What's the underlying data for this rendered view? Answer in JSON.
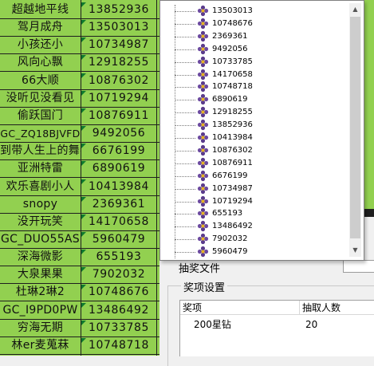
{
  "sheet": {
    "rows": [
      {
        "name": "超越地平线",
        "number": "13852936"
      },
      {
        "name": "驾月成舟",
        "number": "13503013"
      },
      {
        "name": "小孩还小",
        "number": "10734987"
      },
      {
        "name": "风向心飘",
        "number": "12918255"
      },
      {
        "name": "66大顺",
        "number": "10876302"
      },
      {
        "name": "没听见没看见",
        "number": "10719294"
      },
      {
        "name": "偷跃国门",
        "number": "10876911"
      },
      {
        "name": "GC_ZQ18BJVFD",
        "number": "9492056"
      },
      {
        "name": "到带人生上的舞者",
        "number": "6676199"
      },
      {
        "name": "亚洲特雷",
        "number": "6890619"
      },
      {
        "name": "欢乐喜剧小人",
        "number": "10413984"
      },
      {
        "name": "snopy",
        "number": "2369361"
      },
      {
        "name": "没开玩笑",
        "number": "14170658"
      },
      {
        "name": "GC_DUO55AS",
        "number": "5960479"
      },
      {
        "name": "深海微影",
        "number": "655193"
      },
      {
        "name": "大泉果果",
        "number": "7902032"
      },
      {
        "name": "杜琳2琳2",
        "number": "10748676"
      },
      {
        "name": "GC_I9PD0PW",
        "number": "13486492"
      },
      {
        "name": "穷海无期",
        "number": "10733785"
      },
      {
        "name": "林er麦蒐菻",
        "number": "10748718"
      }
    ]
  },
  "tree": {
    "icon": "flower-user-icon",
    "items": [
      "13503013",
      "10748676",
      "2369361",
      "9492056",
      "10733785",
      "14170658",
      "10748718",
      "6890619",
      "12918255",
      "13852936",
      "10413984",
      "10876302",
      "10876911",
      "6676199",
      "10734987",
      "10719294",
      "655193",
      "13486492",
      "7902032",
      "5960479"
    ],
    "scroll_up": "▲",
    "scroll_down": "▼"
  },
  "form": {
    "hidden_label": "抽奖文件"
  },
  "prize": {
    "group_title": "奖项设置",
    "columns": [
      "奖项",
      "抽取人数"
    ],
    "rows": [
      {
        "prize": "200星钻",
        "count": "20"
      }
    ]
  },
  "colors": {
    "sheet_bg": "#92d050",
    "grid_line": "#1e1e1e",
    "comment_flag": "#0f7a2d"
  }
}
